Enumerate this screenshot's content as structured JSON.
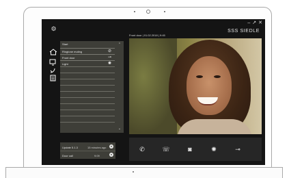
{
  "window": {
    "gear_icon": "gear-icon",
    "controls": [
      "–",
      "↗",
      "✕"
    ],
    "brand": "SSS SIEDLE"
  },
  "video": {
    "caption": "Front door | 01.02.2018 | 9:45"
  },
  "rail": [
    {
      "icon": "home-icon",
      "glyph": "⌂"
    },
    {
      "icon": "monitor-icon",
      "glyph": "▭"
    },
    {
      "icon": "phone-icon",
      "glyph": "✆"
    },
    {
      "icon": "list-icon",
      "glyph": "☰"
    }
  ],
  "panel": {
    "title": "Start",
    "items": [
      {
        "label": "Ringtone muting",
        "icon": "bell-off-icon",
        "glyph": "⊘"
      },
      {
        "label": "Front door",
        "icon": "key-icon",
        "glyph": "⊸"
      },
      {
        "label": "Light",
        "icon": "light-icon",
        "glyph": "✺"
      }
    ],
    "scroll_up": "⌃",
    "scroll_down": "⌄"
  },
  "status": {
    "row1": {
      "label": "Update 5.1.3",
      "value": "15 minutes ago",
      "badge": "●"
    },
    "row2": {
      "label": "Door call",
      "value": "9:09",
      "badge": "●"
    }
  },
  "controls": [
    {
      "name": "call-icon",
      "glyph": "✆"
    },
    {
      "name": "hangup-icon",
      "glyph": "☏"
    },
    {
      "name": "camera-icon",
      "glyph": "◙"
    },
    {
      "name": "light-icon",
      "glyph": "✺"
    },
    {
      "name": "door-key-icon",
      "glyph": "⊸"
    }
  ]
}
